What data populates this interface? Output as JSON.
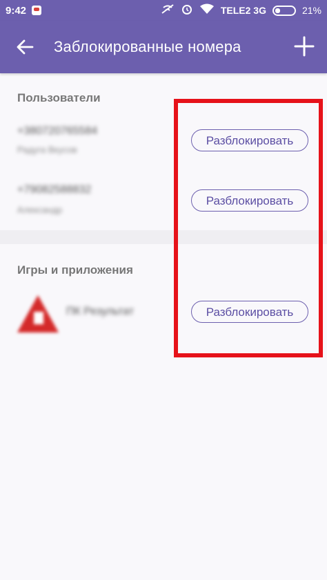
{
  "status_bar": {
    "time": "9:42",
    "carrier": "TELE2 3G",
    "battery": "21%",
    "icons": [
      "notification-icon",
      "signal-off-icon",
      "alarm-icon",
      "wifi-icon",
      "battery-icon"
    ]
  },
  "app_bar": {
    "title": "Заблокированные номера",
    "back_icon": "arrow-left-icon",
    "add_icon": "plus-icon"
  },
  "sections": [
    {
      "header": "Пользователи",
      "items": [
        {
          "primary": "+380720765584",
          "secondary": "Радуга Вкусов",
          "button": "Разблокировать"
        },
        {
          "primary": "+79082588832",
          "secondary": "Александр",
          "button": "Разблокировать"
        }
      ]
    },
    {
      "header": "Игры и приложения",
      "items": [
        {
          "primary": "ПК Результат",
          "button": "Разблокировать"
        }
      ]
    }
  ],
  "colors": {
    "primary": "#6c5fae",
    "highlight": "#e6121a",
    "background": "#f9f8fb"
  }
}
